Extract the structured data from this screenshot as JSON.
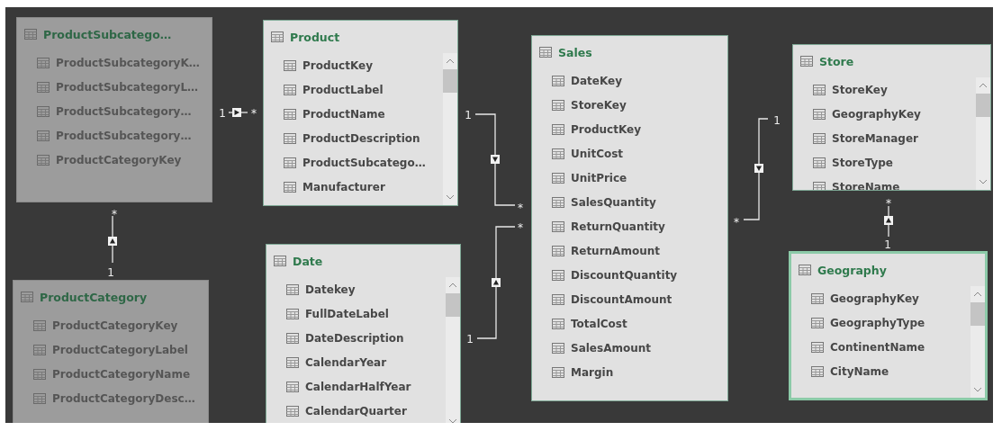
{
  "tables": [
    {
      "name": "ProductSubcatego…",
      "dimmed": true,
      "selected": false,
      "scrollbar": false,
      "columns": [
        "ProductSubcategoryK…",
        "ProductSubcategoryL…",
        "ProductSubcategory…",
        "ProductSubcategory…",
        "ProductCategoryKey"
      ]
    },
    {
      "name": "Product",
      "dimmed": false,
      "selected": false,
      "scrollbar": true,
      "columns": [
        "ProductKey",
        "ProductLabel",
        "ProductName",
        "ProductDescription",
        "ProductSubcatego…",
        "Manufacturer"
      ]
    },
    {
      "name": "Sales",
      "dimmed": false,
      "selected": false,
      "scrollbar": false,
      "columns": [
        "DateKey",
        "StoreKey",
        "ProductKey",
        "UnitCost",
        "UnitPrice",
        "SalesQuantity",
        "ReturnQuantity",
        "ReturnAmount",
        "DiscountQuantity",
        "DiscountAmount",
        "TotalCost",
        "SalesAmount",
        "Margin"
      ]
    },
    {
      "name": "Store",
      "dimmed": false,
      "selected": false,
      "scrollbar": true,
      "columns": [
        "StoreKey",
        "GeographyKey",
        "StoreManager",
        "StoreType",
        "StoreName"
      ]
    },
    {
      "name": "ProductCategory",
      "dimmed": true,
      "selected": false,
      "scrollbar": false,
      "columns": [
        "ProductCategoryKey",
        "ProductCategoryLabel",
        "ProductCategoryName",
        "ProductCategoryDesc…"
      ]
    },
    {
      "name": "Date",
      "dimmed": false,
      "selected": false,
      "scrollbar": true,
      "columns": [
        "Datekey",
        "FullDateLabel",
        "DateDescription",
        "CalendarYear",
        "CalendarHalfYear",
        "CalendarQuarter"
      ]
    },
    {
      "name": "Geography",
      "dimmed": false,
      "selected": true,
      "scrollbar": true,
      "columns": [
        "GeographyKey",
        "GeographyType",
        "ContinentName",
        "CityName"
      ]
    }
  ],
  "relationships": [
    {
      "one": "1",
      "many": "*",
      "kind": "right"
    },
    {
      "one": "1",
      "many": "*",
      "kind": "up"
    },
    {
      "one": "1",
      "many": "*",
      "kind": "down"
    },
    {
      "one": "1",
      "many": "*",
      "kind": "up"
    },
    {
      "one": "1",
      "many": "*",
      "kind": "down"
    },
    {
      "one": "1",
      "many": "*",
      "kind": "up"
    }
  ]
}
